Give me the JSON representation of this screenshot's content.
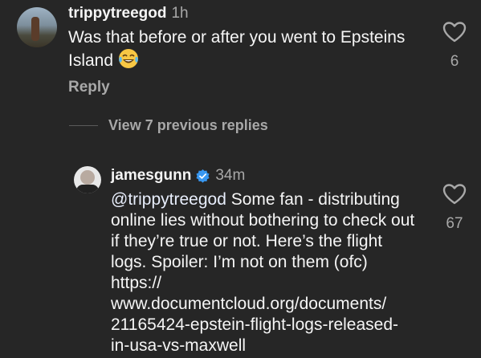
{
  "comments": [
    {
      "username": "trippytreegod",
      "time": "1h",
      "text": "Was that before or after you went to Epsteins Island",
      "emoji": "face-with-tears-of-joy",
      "likes": "6",
      "reply_label": "Reply"
    }
  ],
  "thread": {
    "view_previous_label": "View 7 previous replies"
  },
  "replies": [
    {
      "username": "jamesgunn",
      "verified": true,
      "time": "34m",
      "mention": "@trippytreegod",
      "text": " Some fan - distributing online lies without bothering to check out if they’re true or not. Here’s the flight logs. Spoiler: I’m not on them (ofc) https:// www.documentcloud.org/documents/ 21165424-epstein-flight-logs-released-in-usa-vs-maxwell",
      "likes": "67"
    }
  ],
  "colors": {
    "background": "#262626",
    "secondary_text": "#a8a8a8",
    "verified_badge": "#3897f0"
  }
}
